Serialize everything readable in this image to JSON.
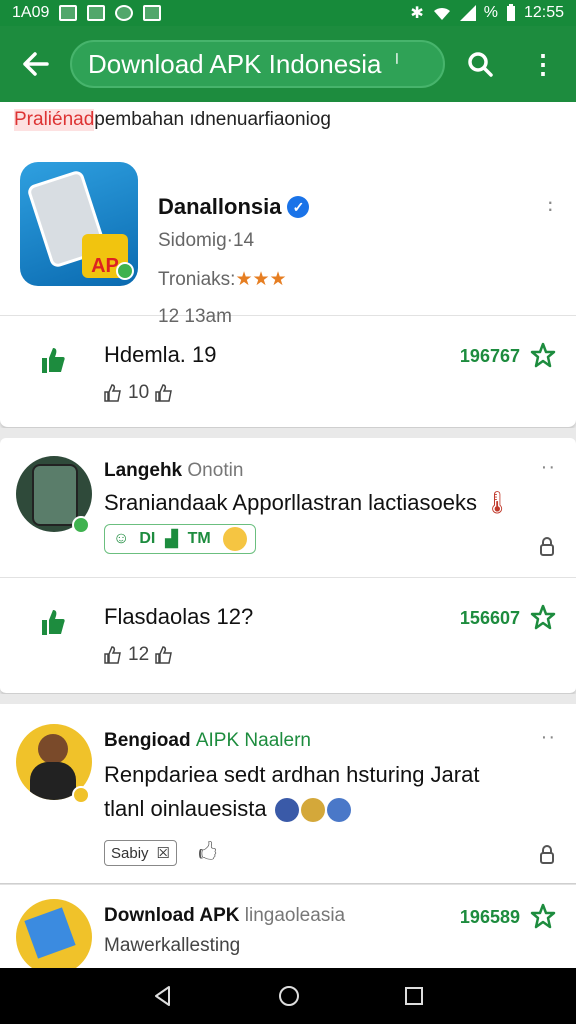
{
  "status": {
    "left_text": "1A09",
    "time": "12:55",
    "battery": "%"
  },
  "appbar": {
    "search_text": "Download APK Indonesia"
  },
  "banner": {
    "highlight": "Praliénad",
    "rest": " pembahan ıdnenuarfiaoniog"
  },
  "app_card": {
    "title": "Danallonsia",
    "subtitle": "Sidomig·14",
    "rating_label": "Troniaks:",
    "rating_stars": "★★★",
    "time": "12 13am",
    "download_title": "Hdemla. 19",
    "download_count": "196767",
    "likes": "10"
  },
  "post1": {
    "author": "Langehk",
    "author_sub": "Onotin",
    "text": "Sraniandaak Apporllastran lactiasoeks",
    "chip_text1": "DI",
    "chip_text2": "TM",
    "download_title": "Flasdaolas 12?",
    "download_count": "156607",
    "likes": "12"
  },
  "post2": {
    "author": "Bengioad",
    "author_green": "AIPK Naalern",
    "text_line1": "Renpdariea sedt ardhan hsturing Jarat",
    "text_line2": "tlanl oinlauesista",
    "react_text": "Sabiy"
  },
  "post3": {
    "author": "Download APK",
    "author_sub": "lingaoleasia",
    "text": "Mawerkallesting",
    "count": "196589"
  },
  "colors": {
    "primary": "#1d8c3e",
    "verified": "#1a73e8",
    "star": "#e67e22"
  }
}
